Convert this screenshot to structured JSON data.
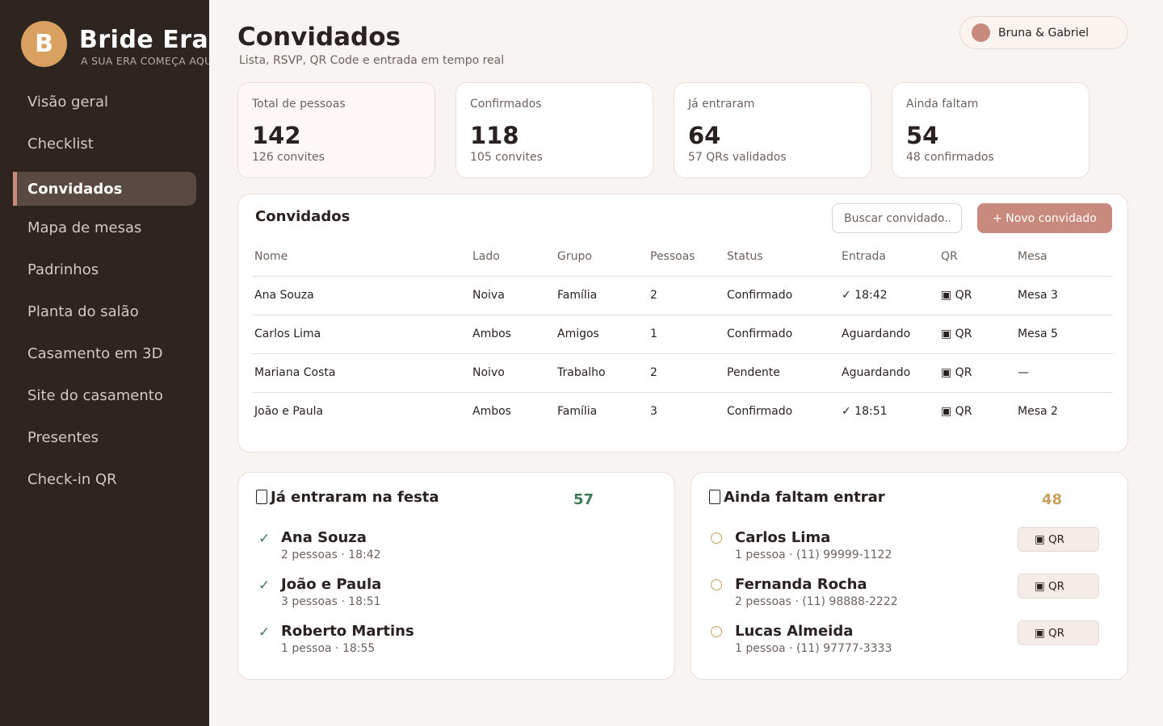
{
  "brand": {
    "initial": "B",
    "name": "Bride Era",
    "tagline": "A SUA ERA COMEÇA AQUI"
  },
  "nav": [
    {
      "label": "Visão geral",
      "active": false
    },
    {
      "label": "Checklist",
      "active": false
    },
    {
      "label": "Convidados",
      "active": true
    },
    {
      "label": "Mapa de mesas",
      "active": false
    },
    {
      "label": "Padrinhos",
      "active": false
    },
    {
      "label": "Planta do salão",
      "active": false
    },
    {
      "label": "Casamento em 3D",
      "active": false
    },
    {
      "label": "Site do casamento",
      "active": false
    },
    {
      "label": "Presentes",
      "active": false
    },
    {
      "label": "Check-in QR",
      "active": false
    }
  ],
  "header": {
    "title": "Convidados",
    "subtitle": "Lista, RSVP, QR Code e entrada em tempo real",
    "user": "Bruna & Gabriel"
  },
  "stats": [
    {
      "label": "Total de pessoas",
      "value": "142",
      "sub": "126 convites"
    },
    {
      "label": "Confirmados",
      "value": "118",
      "sub": "105 convites"
    },
    {
      "label": "Já entraram",
      "value": "64",
      "sub": "57 QRs validados"
    },
    {
      "label": "Ainda faltam",
      "value": "54",
      "sub": "48 confirmados"
    }
  ],
  "guests": {
    "title": "Convidados",
    "search_placeholder": "Buscar convidado...",
    "new_button": "+ Novo convidado",
    "columns": [
      "Nome",
      "Lado",
      "Grupo",
      "Pessoas",
      "Status",
      "Entrada",
      "QR",
      "Mesa"
    ],
    "rows": [
      {
        "name": "Ana Souza",
        "side": "Noiva",
        "group": "Família",
        "people": "2",
        "status": "Confirmado",
        "entry": "✓ 18:42",
        "qr": "▣ QR",
        "table": "Mesa 3"
      },
      {
        "name": "Carlos Lima",
        "side": "Ambos",
        "group": "Amigos",
        "people": "1",
        "status": "Confirmado",
        "entry": "Aguardando",
        "qr": "▣ QR",
        "table": "Mesa 5"
      },
      {
        "name": "Mariana Costa",
        "side": "Noivo",
        "group": "Trabalho",
        "people": "2",
        "status": "Pendente",
        "entry": "Aguardando",
        "qr": "▣ QR",
        "table": "—"
      },
      {
        "name": "João e Paula",
        "side": "Ambos",
        "group": "Família",
        "people": "3",
        "status": "Confirmado",
        "entry": "✓ 18:51",
        "qr": "▣ QR",
        "table": "Mesa 2"
      }
    ]
  },
  "entered": {
    "title": "Já entraram na festa",
    "title_icon": "tofu-glyph-icon",
    "count": "57",
    "items": [
      {
        "name": "Ana Souza",
        "meta": "2 pessoas · 18:42"
      },
      {
        "name": "João e Paula",
        "meta": "3 pessoas · 18:51"
      },
      {
        "name": "Roberto Martins",
        "meta": "1 pessoa · 18:55"
      }
    ]
  },
  "pending": {
    "title": "Ainda faltam entrar",
    "title_icon": "tofu-glyph-icon",
    "count": "48",
    "qr_label": "▣ QR",
    "items": [
      {
        "name": "Carlos Lima",
        "meta": "1 pessoa · (11) 99999-1122"
      },
      {
        "name": "Fernanda Rocha",
        "meta": "2 pessoas · (11) 98888-2222"
      },
      {
        "name": "Lucas Almeida",
        "meta": "1 pessoa · (11) 97777-3333"
      }
    ]
  },
  "colors": {
    "sidebar": "#2e2420",
    "accent": "#c98a7e",
    "gold": "#d9a15f",
    "success": "#3f7a58",
    "pending_count": "#c9a060"
  }
}
